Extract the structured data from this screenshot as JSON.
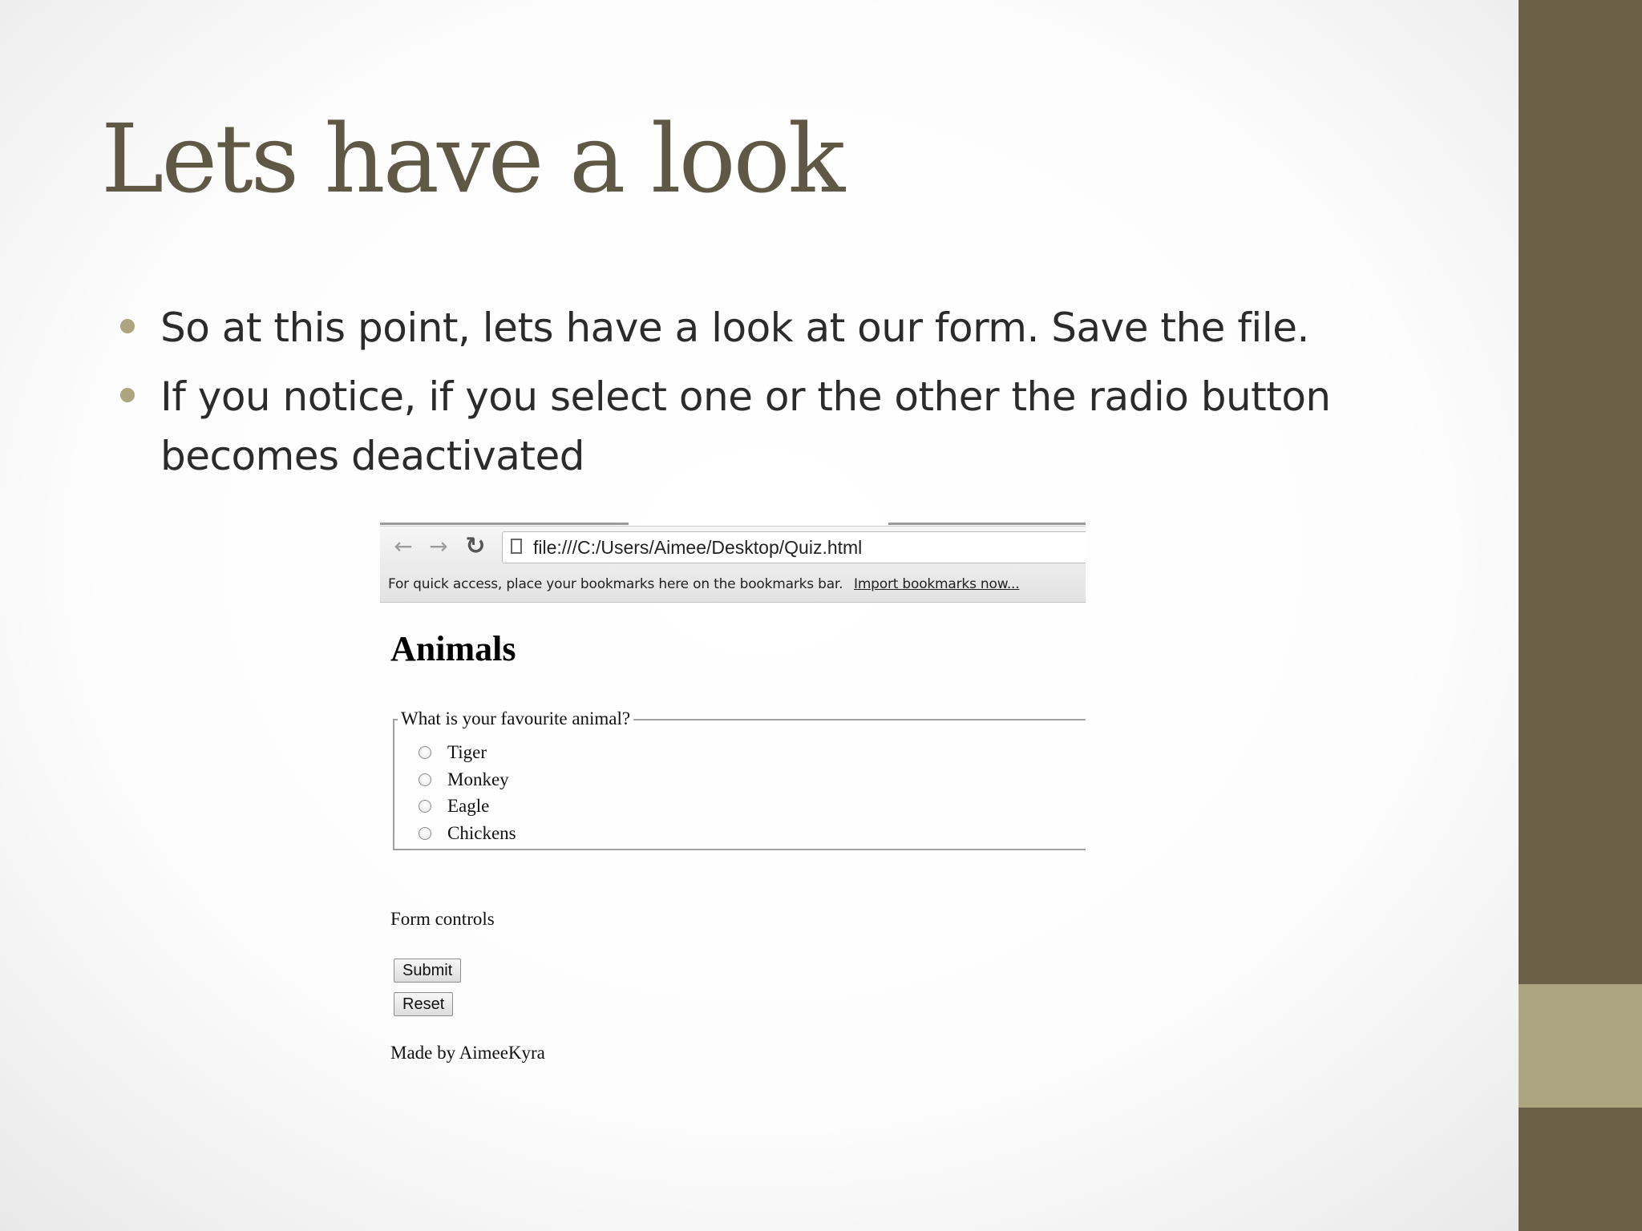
{
  "slide": {
    "title": "Lets have a look",
    "bullets": [
      "So at this point, lets have a look at our form. Save the file.",
      "If you notice, if you select one or the other the radio button becomes deactivated"
    ],
    "colors": {
      "title": "#5e5845",
      "side_bar": "#6b5f48",
      "side_accent": "#aca57f",
      "bullet_dot": "#aca57f"
    }
  },
  "browser": {
    "toolbar": {
      "back_icon": "arrow-left-icon",
      "forward_icon": "arrow-right-icon",
      "reload_icon": "reload-icon",
      "back_glyph": "←",
      "forward_glyph": "→",
      "reload_glyph": "↻"
    },
    "address_bar": {
      "url": "file:///C:/Users/Aimee/Desktop/Quiz.html"
    },
    "bookmarks_bar": {
      "message": "For quick access, place your bookmarks here on the bookmarks bar.",
      "link_label": "Import bookmarks now..."
    }
  },
  "page": {
    "heading": "Animals",
    "fieldset": {
      "legend": "What is your favourite animal?",
      "options": [
        "Tiger",
        "Monkey",
        "Eagle",
        "Chickens"
      ]
    },
    "form_controls_label": "Form controls",
    "submit_label": "Submit",
    "reset_label": "Reset",
    "footer": "Made by AimeeKyra"
  }
}
